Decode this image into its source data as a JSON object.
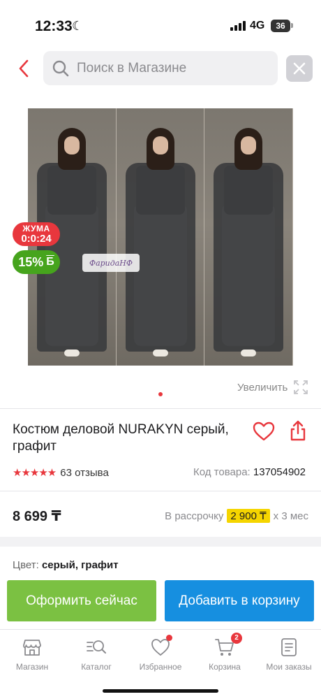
{
  "status_bar": {
    "time": "12:33",
    "network": "4G",
    "battery": "36"
  },
  "search": {
    "placeholder": "Поиск в Магазине"
  },
  "gallery": {
    "watermark": "ФаридаНФ"
  },
  "promo": {
    "day_label": "ЖУМА",
    "timer": "0:0:24",
    "discount": "15%",
    "bonus_symbol": "Б"
  },
  "gallery_controls": {
    "zoom_label": "Увеличить"
  },
  "product": {
    "title": "Костюм деловой NURAKYN серый, графит",
    "rating": 5,
    "reviews_count": "63 отзыва",
    "code_label": "Код товара:",
    "code_value": "137054902",
    "price": "8 699 ₸",
    "installment": {
      "prefix": "В рассрочку",
      "amount": "2 900 ₸",
      "suffix": "х 3 мес"
    },
    "color_label": "Цвет:",
    "color_value": "серый, графит"
  },
  "actions": {
    "order_now": "Оформить сейчас",
    "add_to_cart": "Добавить в корзину"
  },
  "tabbar": {
    "items": [
      {
        "label": "Магазин",
        "icon": "store-icon"
      },
      {
        "label": "Каталог",
        "icon": "catalog-search-icon"
      },
      {
        "label": "Избранное",
        "icon": "heart-icon",
        "dot": true
      },
      {
        "label": "Корзина",
        "icon": "cart-icon",
        "badge": "2"
      },
      {
        "label": "Мои заказы",
        "icon": "orders-icon"
      }
    ]
  },
  "colors": {
    "accent_red": "#e8373d",
    "green": "#7bc142",
    "blue": "#168fe0",
    "yellow": "#f5d500"
  }
}
